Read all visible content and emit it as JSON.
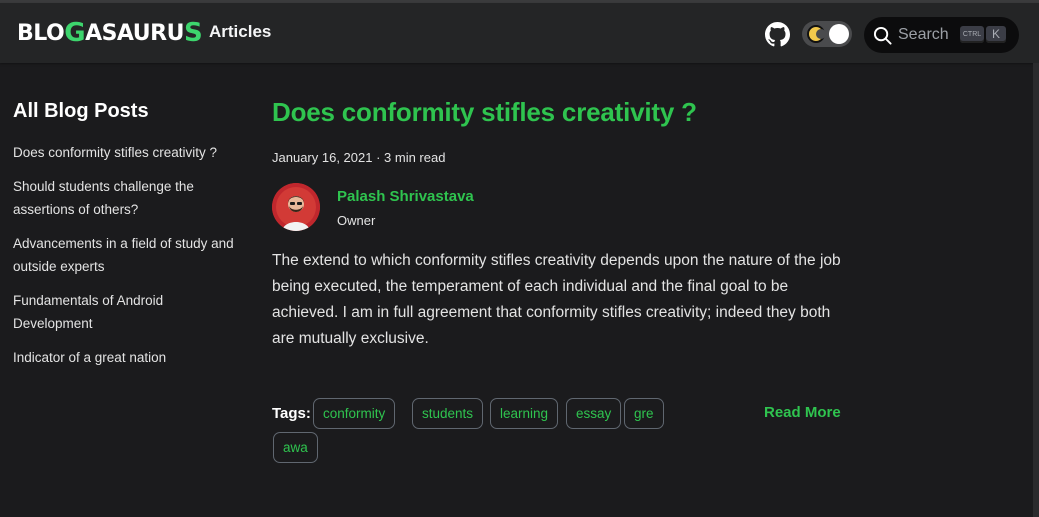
{
  "navbar": {
    "logo_text_left": "BLO",
    "logo_text_mid": "ASAURU",
    "logo_dino_1": "G",
    "logo_dino_2": "S",
    "articles_label": "Articles",
    "github_icon": "github-icon",
    "theme_toggle": "dark-mode-toggle",
    "search_placeholder": "Search",
    "search_key_ctrl": "CTRL",
    "search_key_k": "K"
  },
  "sidebar": {
    "title": "All Blog Posts",
    "items": [
      {
        "label": "Does conformity stifles creativity ?"
      },
      {
        "label": "Should students challenge the assertions of others?"
      },
      {
        "label": "Advancements in a field of study and outside experts"
      },
      {
        "label": "Fundamentals of Android Development"
      },
      {
        "label": "Indicator of a great nation"
      }
    ]
  },
  "post": {
    "title": "Does conformity stifles creativity ?",
    "meta": "January 16, 2021 · 3 min read",
    "author_name": "Palash Shrivastava",
    "author_role": "Owner",
    "excerpt": "The extend to which conformity stifles creativity depends upon the nature of the job being executed, the temperament of each individual and the final goal to be achieved. I am in full agreement that conformity stifles creativity; indeed they both are mutually exclusive.",
    "tags_label": "Tags:",
    "tags": [
      "conformity",
      "students",
      "learning",
      "essay",
      "gre",
      "awa"
    ],
    "read_more": "Read More"
  },
  "colors": {
    "accent": "#2fc44f",
    "background": "#1b1b1d",
    "navbar": "#242526"
  }
}
